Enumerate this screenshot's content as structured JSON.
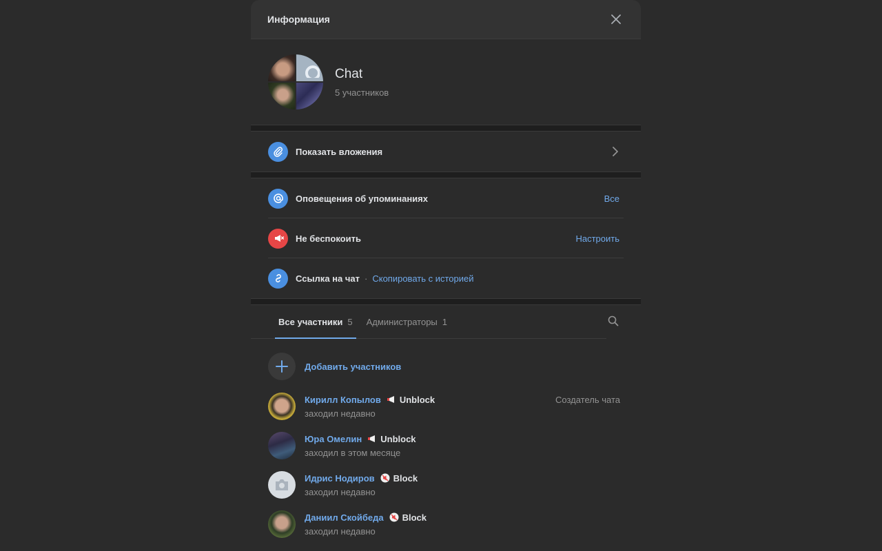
{
  "header": {
    "title": "Информация"
  },
  "chat": {
    "name": "Chat",
    "subtitle": "5 участников"
  },
  "rows": {
    "attachments": {
      "label": "Показать вложения"
    },
    "mentions": {
      "label": "Оповещения об упоминаниях",
      "value": "Все"
    },
    "dnd": {
      "label": "Не беспокоить",
      "value": "Настроить"
    },
    "link": {
      "label": "Ссылка на чат",
      "separator": "·",
      "action": "Скопировать с историей"
    }
  },
  "tabs": [
    {
      "label": "Все участники",
      "count": "5"
    },
    {
      "label": "Администраторы",
      "count": "1"
    }
  ],
  "add_members": {
    "label": "Добавить участников"
  },
  "members": [
    {
      "name": "Кирилл Копылов",
      "badge": "Unblock",
      "status": "заходил недавно",
      "role": "Создатель чата"
    },
    {
      "name": "Юра Омелин",
      "badge": "Unblock",
      "status": "заходил в этом месяце"
    },
    {
      "name": "Идрис Нодиров",
      "badge": "Block",
      "status": "заходил недавно"
    },
    {
      "name": "Даниил Скойбеда",
      "badge": "Block",
      "status": "заходил недавно"
    }
  ],
  "colors": {
    "accent": "#71aaeb",
    "icon_blue": "#4a8fe0",
    "icon_red": "#e64646",
    "background": "#2b2b2b"
  },
  "icons": {
    "close": "close-icon",
    "attach": "paperclip-icon",
    "mention": "at-icon",
    "dnd": "megaphone-off-icon",
    "link": "link-icon",
    "search": "search-icon",
    "add": "plus-icon",
    "chevron": "chevron-right-icon"
  }
}
